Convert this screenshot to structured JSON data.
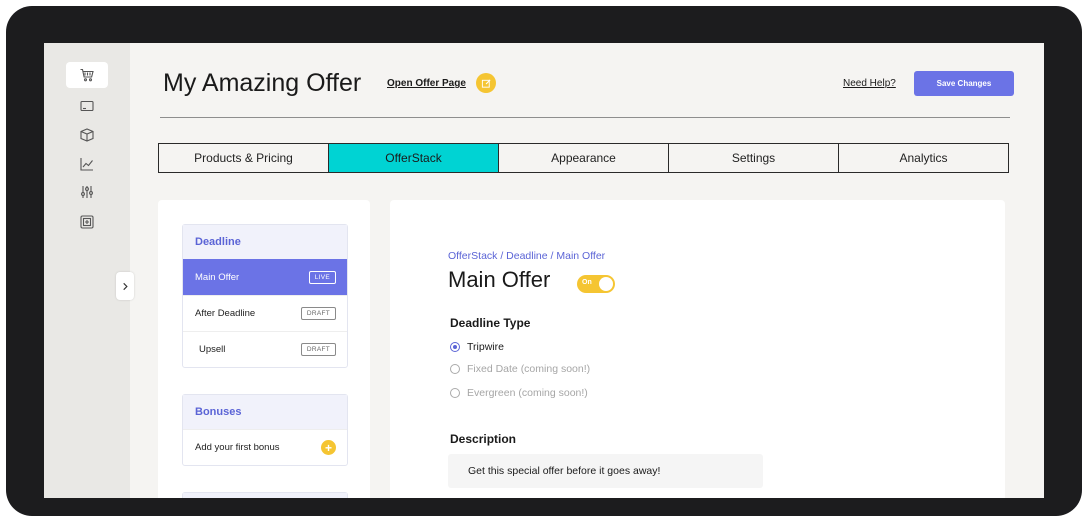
{
  "header": {
    "title": "My Amazing Offer",
    "open_offer_link": "Open Offer Page",
    "help_link": "Need Help?",
    "save_button": "Save Changes"
  },
  "nav": {
    "rail_icons": [
      "cart-icon",
      "credit-card-icon",
      "box-icon",
      "chart-icon",
      "sliders-icon",
      "add-square-icon"
    ],
    "active_icon": "cart-icon",
    "collapse_icon": "chevron-right-icon"
  },
  "tabs": [
    {
      "label": "Products & Pricing",
      "active": false
    },
    {
      "label": "OfferStack",
      "active": true
    },
    {
      "label": "Appearance",
      "active": false
    },
    {
      "label": "Settings",
      "active": false
    },
    {
      "label": "Analytics",
      "active": false
    }
  ],
  "sidebar": {
    "deadline": {
      "header": "Deadline",
      "items": [
        {
          "label": "Main Offer",
          "badge": "LIVE",
          "active": true
        },
        {
          "label": "After Deadline",
          "badge": "DRAFT",
          "active": false
        },
        {
          "label": "Upsell",
          "badge": "DRAFT",
          "active": false
        }
      ]
    },
    "bonuses": {
      "header": "Bonuses",
      "add_label": "Add your first bonus"
    }
  },
  "main": {
    "breadcrumb": "OfferStack / Deadline / Main Offer",
    "title": "Main Offer",
    "toggle_label": "On",
    "deadline_type_label": "Deadline Type",
    "deadline_options": [
      {
        "label": "Tripwire",
        "checked": true,
        "disabled": false
      },
      {
        "label": "Fixed Date (coming soon!)",
        "checked": false,
        "disabled": true
      },
      {
        "label": "Evergreen (coming soon!)",
        "checked": false,
        "disabled": true
      }
    ],
    "description_label": "Description",
    "description_value": "Get this special offer before it goes away!"
  },
  "colors": {
    "accent": "#6b73e6",
    "active_tab": "#00d3d3",
    "yellow": "#f5c532"
  }
}
